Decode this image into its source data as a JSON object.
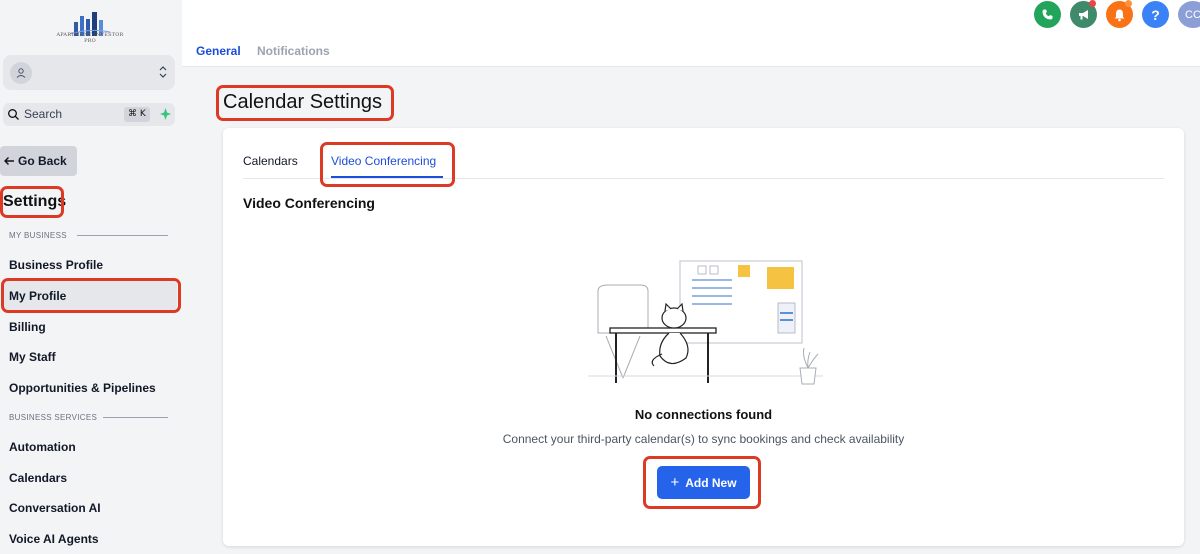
{
  "brand": {
    "logo_text": "APARTMENT INVESTOR PRO"
  },
  "sidebar": {
    "search_label": "Search",
    "search_shortcut": "⌘ K",
    "go_back_label": "Go Back",
    "settings_title": "Settings",
    "sections": [
      {
        "label": "MY BUSINESS"
      },
      {
        "label": "BUSINESS SERVICES"
      }
    ],
    "items": [
      {
        "label": "Business Profile"
      },
      {
        "label": "My Profile"
      },
      {
        "label": "Billing"
      },
      {
        "label": "My Staff"
      },
      {
        "label": "Opportunities & Pipelines"
      },
      {
        "label": "Automation"
      },
      {
        "label": "Calendars"
      },
      {
        "label": "Conversation AI"
      },
      {
        "label": "Voice AI Agents"
      }
    ]
  },
  "header": {
    "tabs": [
      {
        "label": "General",
        "active": true
      },
      {
        "label": "Notifications",
        "active": false
      }
    ],
    "buttons": [
      {
        "icon": "phone-icon",
        "color": "#22a55a"
      },
      {
        "icon": "megaphone-icon",
        "color": "#3f8a6b"
      },
      {
        "icon": "bell-icon",
        "color": "#f97316"
      },
      {
        "icon": "help-icon",
        "color": "#3b82f6"
      }
    ],
    "user_initials": "CC"
  },
  "main": {
    "page_title": "Calendar Settings",
    "tabs": [
      {
        "label": "Calendars",
        "active": false
      },
      {
        "label": "Video Conferencing",
        "active": true
      }
    ],
    "section_heading": "Video Conferencing",
    "empty_title": "No connections found",
    "empty_description": "Connect your third-party calendar(s) to sync bookings and check availability",
    "add_button_label": "Add New"
  },
  "colors": {
    "accent": "#2563eb",
    "annotation": "#dc3a24"
  }
}
